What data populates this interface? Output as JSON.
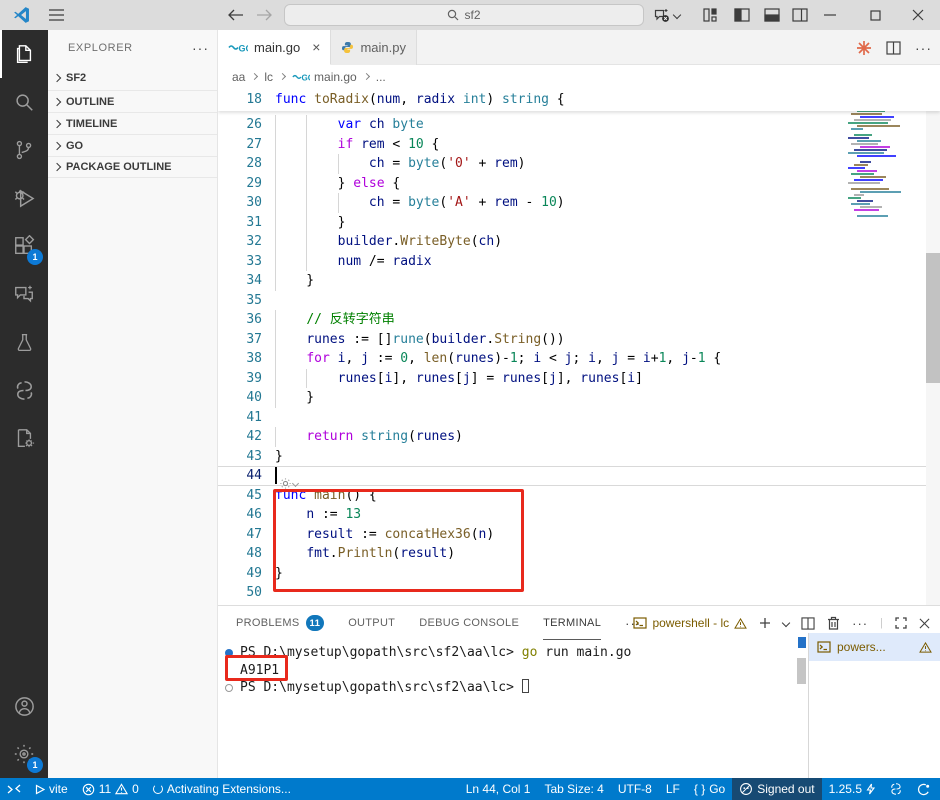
{
  "title_bar": {
    "search_value": "sf2"
  },
  "activity_bar": {
    "extensions_badge": "1",
    "settings_badge": "1"
  },
  "sidebar": {
    "title": "EXPLORER",
    "actions": "···",
    "sections": [
      {
        "label": "SF2"
      },
      {
        "label": "OUTLINE"
      },
      {
        "label": "TIMELINE"
      },
      {
        "label": "GO"
      },
      {
        "label": "PACKAGE OUTLINE"
      }
    ]
  },
  "tabs": [
    {
      "label": "main.go",
      "icon": "go-icon",
      "active": true
    },
    {
      "label": "main.py",
      "icon": "python-icon",
      "active": false
    }
  ],
  "breadcrumb": {
    "items": [
      "aa",
      "lc",
      "main.go",
      "..."
    ]
  },
  "editor": {
    "sticky_line": {
      "n": 18,
      "t": [
        [
          "k",
          "func"
        ],
        [
          "d",
          " "
        ],
        [
          "f",
          "toRadix"
        ],
        [
          "d",
          "("
        ],
        [
          "v",
          "num"
        ],
        [
          "d",
          ", "
        ],
        [
          "v",
          "radix"
        ],
        [
          "d",
          " "
        ],
        [
          "t",
          "int"
        ],
        [
          "d",
          ") "
        ],
        [
          "t",
          "string"
        ],
        [
          "d",
          " {"
        ]
      ]
    },
    "cursor_line": 44,
    "lines": [
      {
        "n": 26,
        "t": [
          [
            "d",
            "        "
          ],
          [
            "k",
            "var"
          ],
          [
            "d",
            " "
          ],
          [
            "v",
            "ch"
          ],
          [
            "d",
            " "
          ],
          [
            "t",
            "byte"
          ]
        ]
      },
      {
        "n": 27,
        "t": [
          [
            "d",
            "        "
          ],
          [
            "c",
            "if"
          ],
          [
            "d",
            " "
          ],
          [
            "v",
            "rem"
          ],
          [
            "d",
            " < "
          ],
          [
            "n",
            "10"
          ],
          [
            "d",
            " {"
          ]
        ]
      },
      {
        "n": 28,
        "t": [
          [
            "d",
            "            "
          ],
          [
            "v",
            "ch"
          ],
          [
            "d",
            " = "
          ],
          [
            "t",
            "byte"
          ],
          [
            "d",
            "("
          ],
          [
            "s",
            "'0'"
          ],
          [
            "d",
            " + "
          ],
          [
            "v",
            "rem"
          ],
          [
            "d",
            ")"
          ]
        ]
      },
      {
        "n": 29,
        "t": [
          [
            "d",
            "        } "
          ],
          [
            "c",
            "else"
          ],
          [
            "d",
            " {"
          ]
        ]
      },
      {
        "n": 30,
        "t": [
          [
            "d",
            "            "
          ],
          [
            "v",
            "ch"
          ],
          [
            "d",
            " = "
          ],
          [
            "t",
            "byte"
          ],
          [
            "d",
            "("
          ],
          [
            "s",
            "'A'"
          ],
          [
            "d",
            " + "
          ],
          [
            "v",
            "rem"
          ],
          [
            "d",
            " - "
          ],
          [
            "n",
            "10"
          ],
          [
            "d",
            ")"
          ]
        ]
      },
      {
        "n": 31,
        "t": [
          [
            "d",
            "        }"
          ]
        ]
      },
      {
        "n": 32,
        "t": [
          [
            "d",
            "        "
          ],
          [
            "v",
            "builder"
          ],
          [
            "d",
            "."
          ],
          [
            "f",
            "WriteByte"
          ],
          [
            "d",
            "("
          ],
          [
            "v",
            "ch"
          ],
          [
            "d",
            ")"
          ]
        ]
      },
      {
        "n": 33,
        "t": [
          [
            "d",
            "        "
          ],
          [
            "v",
            "num"
          ],
          [
            "d",
            " /= "
          ],
          [
            "v",
            "radix"
          ]
        ]
      },
      {
        "n": 34,
        "t": [
          [
            "d",
            "    }"
          ]
        ]
      },
      {
        "n": 35,
        "t": []
      },
      {
        "n": 36,
        "t": [
          [
            "d",
            "    "
          ],
          [
            "m",
            "// 反转字符串"
          ]
        ]
      },
      {
        "n": 37,
        "t": [
          [
            "d",
            "    "
          ],
          [
            "v",
            "runes"
          ],
          [
            "d",
            " := []"
          ],
          [
            "t",
            "rune"
          ],
          [
            "d",
            "("
          ],
          [
            "v",
            "builder"
          ],
          [
            "d",
            "."
          ],
          [
            "f",
            "String"
          ],
          [
            "d",
            "())"
          ]
        ]
      },
      {
        "n": 38,
        "t": [
          [
            "d",
            "    "
          ],
          [
            "c",
            "for"
          ],
          [
            "d",
            " "
          ],
          [
            "v",
            "i"
          ],
          [
            "d",
            ", "
          ],
          [
            "v",
            "j"
          ],
          [
            "d",
            " := "
          ],
          [
            "n",
            "0"
          ],
          [
            "d",
            ", "
          ],
          [
            "f",
            "len"
          ],
          [
            "d",
            "("
          ],
          [
            "v",
            "runes"
          ],
          [
            "d",
            ")-"
          ],
          [
            "n",
            "1"
          ],
          [
            "d",
            "; "
          ],
          [
            "v",
            "i"
          ],
          [
            "d",
            " < "
          ],
          [
            "v",
            "j"
          ],
          [
            "d",
            "; "
          ],
          [
            "v",
            "i"
          ],
          [
            "d",
            ", "
          ],
          [
            "v",
            "j"
          ],
          [
            "d",
            " = "
          ],
          [
            "v",
            "i"
          ],
          [
            "d",
            "+"
          ],
          [
            "n",
            "1"
          ],
          [
            "d",
            ", "
          ],
          [
            "v",
            "j"
          ],
          [
            "d",
            "-"
          ],
          [
            "n",
            "1"
          ],
          [
            "d",
            " {"
          ]
        ]
      },
      {
        "n": 39,
        "t": [
          [
            "d",
            "        "
          ],
          [
            "v",
            "runes"
          ],
          [
            "d",
            "["
          ],
          [
            "v",
            "i"
          ],
          [
            "d",
            "], "
          ],
          [
            "v",
            "runes"
          ],
          [
            "d",
            "["
          ],
          [
            "v",
            "j"
          ],
          [
            "d",
            "] = "
          ],
          [
            "v",
            "runes"
          ],
          [
            "d",
            "["
          ],
          [
            "v",
            "j"
          ],
          [
            "d",
            "], "
          ],
          [
            "v",
            "runes"
          ],
          [
            "d",
            "["
          ],
          [
            "v",
            "i"
          ],
          [
            "d",
            "]"
          ]
        ]
      },
      {
        "n": 40,
        "t": [
          [
            "d",
            "    }"
          ]
        ]
      },
      {
        "n": 41,
        "t": []
      },
      {
        "n": 42,
        "t": [
          [
            "d",
            "    "
          ],
          [
            "c",
            "return"
          ],
          [
            "d",
            " "
          ],
          [
            "t",
            "string"
          ],
          [
            "d",
            "("
          ],
          [
            "v",
            "runes"
          ],
          [
            "d",
            ")"
          ]
        ]
      },
      {
        "n": 43,
        "t": [
          [
            "d",
            "}"
          ]
        ]
      },
      {
        "n": 44,
        "t": []
      },
      {
        "n": 45,
        "t": [
          [
            "k",
            "func"
          ],
          [
            "d",
            " "
          ],
          [
            "f",
            "main"
          ],
          [
            "d",
            "() {"
          ]
        ]
      },
      {
        "n": 46,
        "t": [
          [
            "d",
            "    "
          ],
          [
            "v",
            "n"
          ],
          [
            "d",
            " := "
          ],
          [
            "n",
            "13"
          ]
        ]
      },
      {
        "n": 47,
        "t": [
          [
            "d",
            "    "
          ],
          [
            "v",
            "result"
          ],
          [
            "d",
            " := "
          ],
          [
            "f",
            "concatHex36"
          ],
          [
            "d",
            "("
          ],
          [
            "v",
            "n"
          ],
          [
            "d",
            ")"
          ]
        ]
      },
      {
        "n": 48,
        "t": [
          [
            "d",
            "    "
          ],
          [
            "v",
            "fmt"
          ],
          [
            "d",
            "."
          ],
          [
            "f",
            "Println"
          ],
          [
            "d",
            "("
          ],
          [
            "v",
            "result"
          ],
          [
            "d",
            ")"
          ]
        ]
      },
      {
        "n": 49,
        "t": [
          [
            "d",
            "}"
          ]
        ]
      },
      {
        "n": 50,
        "t": []
      }
    ]
  },
  "panel": {
    "tabs": [
      {
        "label": "PROBLEMS",
        "badge": "11",
        "active": false
      },
      {
        "label": "OUTPUT",
        "active": false
      },
      {
        "label": "DEBUG CONSOLE",
        "active": false
      },
      {
        "label": "TERMINAL",
        "active": true
      }
    ],
    "more": "···",
    "terminal_name": "powershell - lc",
    "terminal_tab_item": "powers...",
    "terminal_lines": [
      {
        "deco": "filled",
        "tokens": [
          [
            "p",
            "PS D:\\mysetup\\gopath\\src\\sf2\\aa\\lc> "
          ],
          [
            "g",
            "go"
          ],
          [
            "p",
            " run main.go"
          ]
        ],
        "cursor": false
      },
      {
        "deco": "none",
        "tokens": [
          [
            "p",
            "A91P1"
          ]
        ],
        "cursor": false
      },
      {
        "deco": "empty",
        "tokens": [
          [
            "p",
            "PS D:\\mysetup\\gopath\\src\\sf2\\aa\\lc> "
          ]
        ],
        "cursor": true
      }
    ]
  },
  "status_bar": {
    "vite": "vite",
    "errors": "11",
    "warnings": "0",
    "activating": "Activating Extensions...",
    "line_col": "Ln 44, Col 1",
    "tab_size": "Tab Size: 4",
    "encoding": "UTF-8",
    "eol": "LF",
    "lang_braces": "{ }",
    "language": "Go",
    "signed_out": "Signed out",
    "version": "1.25.5"
  },
  "colors": {
    "annotation": "#e8291c",
    "accent": "#007acc",
    "badge": "#1177bb",
    "minimap_palette": [
      "#0000ff",
      "#267f99",
      "#795e26",
      "#001080",
      "#098658",
      "#af00db",
      "#9a9a9a"
    ]
  }
}
